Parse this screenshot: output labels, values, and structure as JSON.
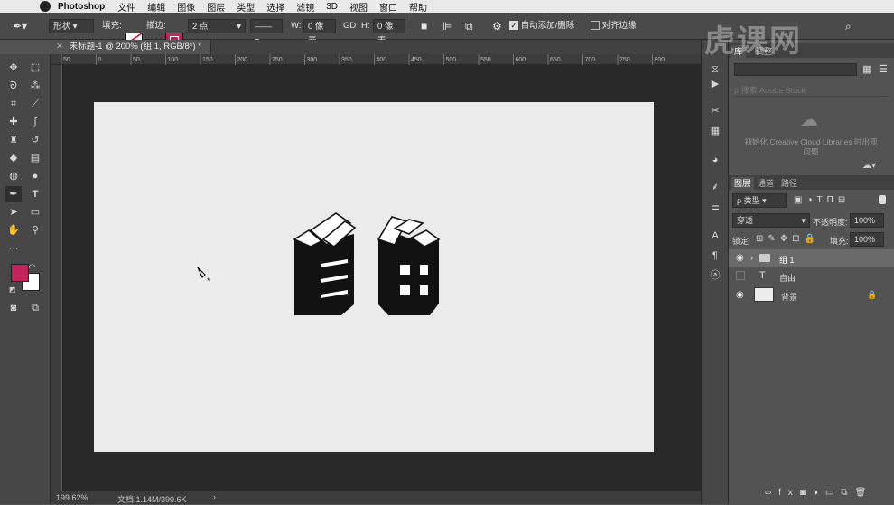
{
  "menubar": {
    "app": "Photoshop",
    "items": [
      "文件",
      "编辑",
      "图像",
      "图层",
      "类型",
      "选择",
      "滤镜",
      "3D",
      "视图",
      "窗口",
      "帮助"
    ]
  },
  "options": {
    "mode": "形状",
    "fill_label": "填充:",
    "stroke_label": "描边:",
    "stroke_width": "2 点",
    "w_label": "W:",
    "w_value": "0 像素",
    "link_icon": "GD",
    "h_label": "H:",
    "h_value": "0 像素",
    "auto_add_delete": "自动添加/删除",
    "align_edges": "对齐边缘",
    "stroke_color": "#c0245a"
  },
  "document": {
    "tab_title": "未标题-1 @ 200% (组 1, RGB/8*) *",
    "ruler_labels": [
      "50",
      "0",
      "50",
      "100",
      "150",
      "200",
      "250",
      "300",
      "350",
      "400",
      "450",
      "500",
      "550",
      "600",
      "650",
      "700",
      "750",
      "800"
    ],
    "zoom": "199.62%",
    "doc_size": "文档:1.14M/390.6K"
  },
  "colors": {
    "foreground": "#c0245a",
    "background": "#ffffff"
  },
  "panels": {
    "top_tabs": [
      "库",
      "调整"
    ],
    "cloud_message": "初始化 Creative Cloud Libraries 时出现问题",
    "search_placeholder": "搜索 Adobe Stock",
    "layer_tabs": [
      "图层",
      "通道",
      "路径"
    ],
    "filter_kind": "ρ 类型",
    "blend_mode": "穿透",
    "opacity_label": "不透明度:",
    "opacity_value": "100%",
    "lock_label": "锁定:",
    "fill_label": "填充:",
    "fill_value": "100%",
    "layers": [
      {
        "name": "组 1",
        "kind": "group",
        "visible": true,
        "selected": true
      },
      {
        "name": "自由",
        "kind": "text",
        "visible": false,
        "selected": false
      },
      {
        "name": "背景",
        "kind": "background",
        "visible": true,
        "selected": false,
        "locked": true
      }
    ]
  },
  "watermark": "虎课网"
}
